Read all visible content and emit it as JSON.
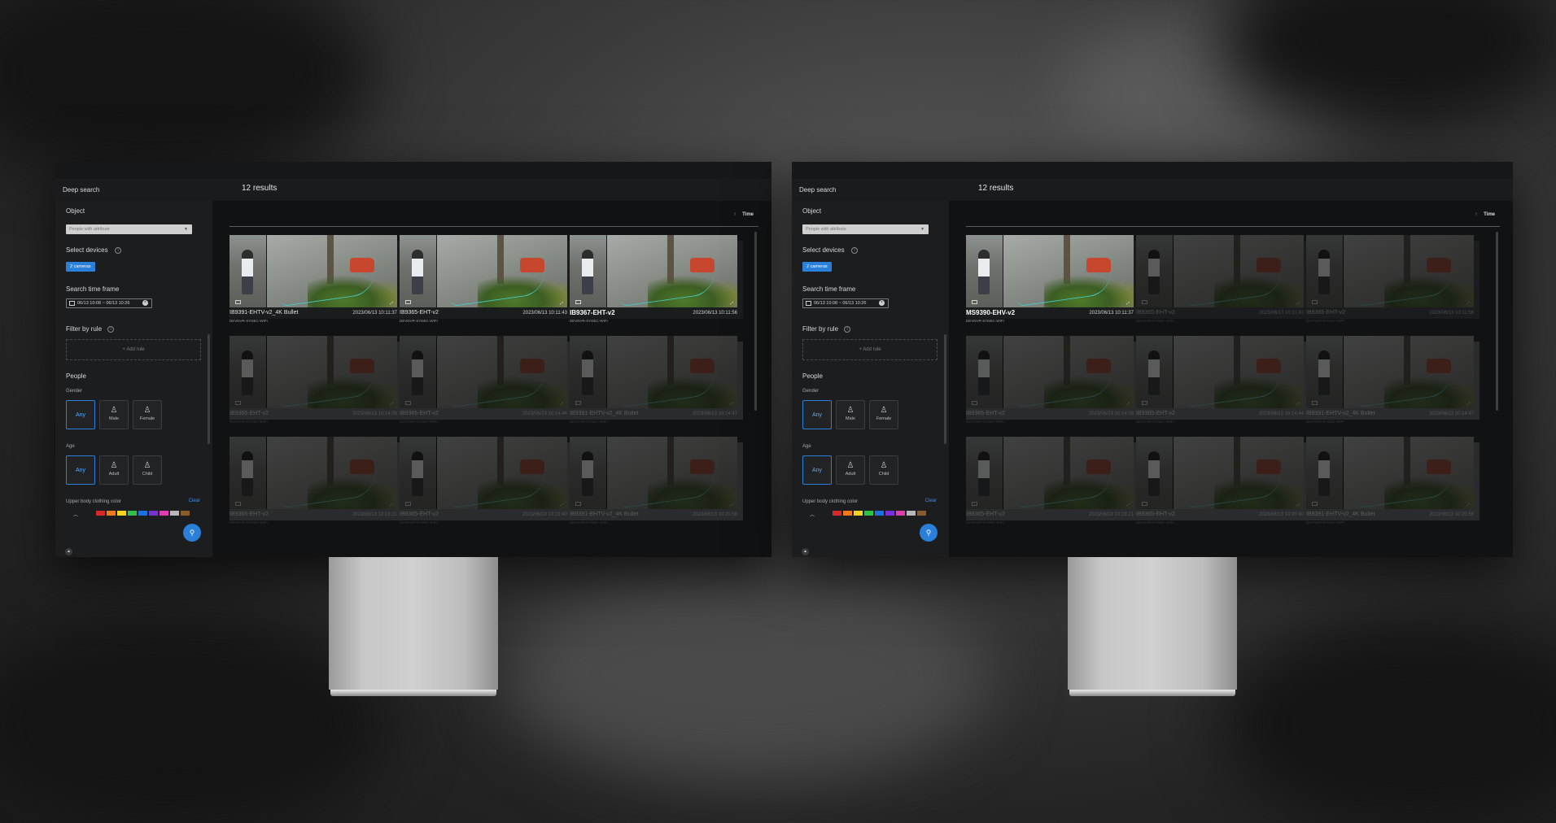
{
  "screens": [
    {
      "app_title": "Deep search",
      "results_count": "12 results",
      "sort": {
        "icon": "arrow-up-icon",
        "label": "Time"
      },
      "sidebar": {
        "object_label": "Object",
        "object_value": "People with attribute",
        "select_devices_label": "Select devices",
        "devices_chip": "2 cameras",
        "time_frame_label": "Search time frame",
        "time_frame_value": "06/13 10:08 ~ 06/13 10:26",
        "filter_label": "Filter by rule",
        "add_rule": "+ Add rule",
        "people_label": "People",
        "gender_label": "Gender",
        "gender_options": [
          "Any",
          "Male",
          "Female"
        ],
        "gender_selected": "Any",
        "age_label": "Age",
        "age_options": [
          "Any",
          "Adult",
          "Child"
        ],
        "age_selected": "Any",
        "upper_color_label": "Upper body clothing color",
        "clear_label": "Clear"
      },
      "results": [
        {
          "camera": "IB9391-EHTV-v2_4K Bullet",
          "time": "2023/06/13 10:11:37",
          "device": "DEVNVR-SYDEC-WIFI",
          "highlight": true
        },
        {
          "camera": "IB9365-EHT-v2",
          "time": "2023/06/13 10:11:43",
          "device": "DEVNVR-SYDEC-WIFI",
          "highlight": true
        },
        {
          "camera": "IB9367-EHT-v2",
          "time": "2023/06/13 10:11:56",
          "device": "DEVNVR-SYDEC-WIFI",
          "highlight": true,
          "bold": true
        },
        {
          "camera": "IB9365-EHT-v2",
          "time": "2023/06/13 10:14:08",
          "device": "DEVNVR-SYDEC-WIFI",
          "highlight": false
        },
        {
          "camera": "IB9365-EHT-v2",
          "time": "2023/06/13 10:14:44",
          "device": "DEVNVR-SYDEC-WIFI",
          "highlight": false
        },
        {
          "camera": "IB9391-EHTV-v2_4K Bullet",
          "time": "2023/06/13 10:14:47",
          "device": "DEVNVR-SYDEC-WIFI",
          "highlight": false
        },
        {
          "camera": "IB9365-EHT-v2",
          "time": "2023/06/13 10:19:21",
          "device": "DEVNVR-SYDEC-WIFI",
          "highlight": false
        },
        {
          "camera": "IB9365-EHT-v2",
          "time": "2023/06/13 10:19:40",
          "device": "DEVNVR-SYDEC-WIFI",
          "highlight": false
        },
        {
          "camera": "IB9391-EHTV-v2_4K Bullet",
          "time": "2023/06/13 10:20:56",
          "device": "DEVNVR-SYDEC-WIFI",
          "highlight": false
        }
      ]
    },
    {
      "app_title": "Deep search",
      "results_count": "12 results",
      "sort": {
        "icon": "arrow-up-icon",
        "label": "Time"
      },
      "sidebar": {
        "object_label": "Object",
        "object_value": "People with attribute",
        "select_devices_label": "Select devices",
        "devices_chip": "2 cameras",
        "time_frame_label": "Search time frame",
        "time_frame_value": "06/13 10:08 ~ 06/13 10:26",
        "filter_label": "Filter by rule",
        "add_rule": "+ Add rule",
        "people_label": "People",
        "gender_label": "Gender",
        "gender_options": [
          "Any",
          "Male",
          "Female"
        ],
        "gender_selected": "Any",
        "age_label": "Age",
        "age_options": [
          "Any",
          "Adult",
          "Child"
        ],
        "age_selected": "Any",
        "upper_color_label": "Upper body clothing color",
        "clear_label": "Clear"
      },
      "results": [
        {
          "camera": "MS9390-EHV-v2",
          "time": "2023/06/13 10:11:37",
          "device": "DEVNVR-SYDEC-WIFI",
          "highlight": true,
          "bold": true
        },
        {
          "camera": "IB9365-EHT-v2",
          "time": "2023/06/13 10:11:43",
          "device": "DEVNVR-SYDEC-WIFI",
          "highlight": false
        },
        {
          "camera": "IB9365-EHT-v2",
          "time": "2023/06/13 10:11:56",
          "device": "DEVNVR-SYDEC-WIFI",
          "highlight": false
        },
        {
          "camera": "IB9365-EHT-v2",
          "time": "2023/06/13 10:14:08",
          "device": "DEVNVR-SYDEC-WIFI",
          "highlight": false
        },
        {
          "camera": "IB9365-EHT-v2",
          "time": "2023/06/13 10:14:44",
          "device": "DEVNVR-SYDEC-WIFI",
          "highlight": false
        },
        {
          "camera": "IB9391-EHTV-v2_4K Bullet",
          "time": "2023/06/13 10:14:47",
          "device": "DEVNVR-SYDEC-WIFI",
          "highlight": false
        },
        {
          "camera": "IB9365-EHT-v2",
          "time": "2023/06/13 10:19:21",
          "device": "DEVNVR-SYDEC-WIFI",
          "highlight": false
        },
        {
          "camera": "IB9365-EHT-v2",
          "time": "2023/06/13 10:20:40",
          "device": "DEVNVR-SYDEC-WIFI",
          "highlight": false
        },
        {
          "camera": "IB9391-EHTV-v2_4K Bullet",
          "time": "2023/06/13 10:20:56",
          "device": "DEVNVR-SYDEC-WIFI",
          "highlight": false
        }
      ]
    }
  ],
  "colors": {
    "accent": "#2a7fd8",
    "track_line": "#3fd0c8",
    "swatches": [
      "#d42a2a",
      "#f07a1a",
      "#f4d21f",
      "#2fbf4a",
      "#1e6fe0",
      "#7b2fd6",
      "#e03bb0",
      "#b8b8b8",
      "#8a5a2b"
    ]
  }
}
